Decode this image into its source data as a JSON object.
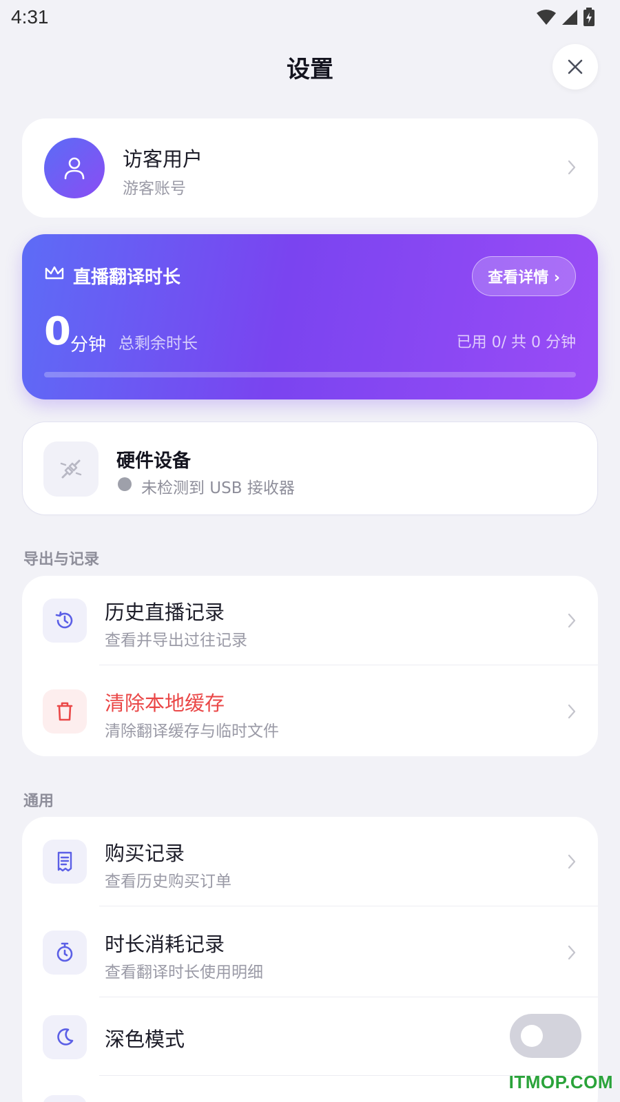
{
  "status_bar": {
    "time": "4:31"
  },
  "header": {
    "title": "设置"
  },
  "profile": {
    "name": "访客用户",
    "subtitle": "游客账号"
  },
  "live_time": {
    "title": "直播翻译时长",
    "detail_button": "查看详情 ›",
    "remaining_value": "0",
    "unit": "分钟",
    "remaining_label": "总剩余时长",
    "usage_text": "已用 0/ 共 0 分钟",
    "progress_fraction": 0
  },
  "hardware": {
    "title": "硬件设备",
    "status": "未检测到 USB 接收器",
    "status_color": "#9ea0aa"
  },
  "sections": {
    "export": {
      "label": "导出与记录",
      "items": [
        {
          "title": "历史直播记录",
          "subtitle": "查看并导出过往记录",
          "icon": "history-icon"
        },
        {
          "title": "清除本地缓存",
          "subtitle": "清除翻译缓存与临时文件",
          "icon": "trash-icon",
          "color": "#ea4747"
        }
      ]
    },
    "general": {
      "label": "通用",
      "items": [
        {
          "title": "购买记录",
          "subtitle": "查看历史购买订单",
          "icon": "receipt-icon"
        },
        {
          "title": "时长消耗记录",
          "subtitle": "查看翻译时长使用明细",
          "icon": "stopwatch-icon"
        },
        {
          "title": "深色模式",
          "icon": "moon-icon",
          "toggle_on": false
        }
      ]
    }
  },
  "watermark": "ITMOP.COM",
  "colors": {
    "accent": "#5b5fe6",
    "gradient_start": "#5d6cf6",
    "gradient_end": "#9a4cf6",
    "danger": "#ea4747",
    "background": "#f2f2f7"
  }
}
